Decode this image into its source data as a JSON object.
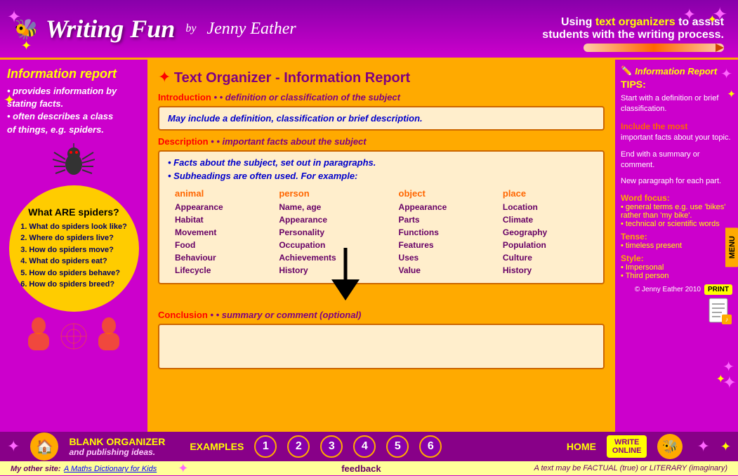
{
  "header": {
    "logo": "Writing Fun",
    "by": "by",
    "author": "Jenny Eather",
    "tagline_prefix": "Using ",
    "tagline_highlight": "text organizers",
    "tagline_suffix": " to assist",
    "tagline_line2": "students with the writing process."
  },
  "left_panel": {
    "title": "Information report",
    "bullet1": "• provides information by",
    "bullet1b": "  stating facts.",
    "bullet2": "• often describes a class",
    "bullet2b": "  of things, e.g. spiders.",
    "circle_title": "What ARE spiders?",
    "questions": [
      "1. What do spiders look like?",
      "2. Where do spiders live?",
      "3. How do spiders move?",
      "4. What do spiders eat?",
      "5. How do spiders behave?",
      "6. How do spiders breed?"
    ]
  },
  "center_panel": {
    "title": "Text Organizer - Information Report",
    "intro_header": "Introduction",
    "intro_subheader": "• definition or classification of the subject",
    "intro_box": "May include a definition, classification or brief description.",
    "desc_header": "Description",
    "desc_subheader": "• important facts about the subject",
    "desc_bullet1": "• Facts about the subject, set out in paragraphs.",
    "desc_bullet2": "• Subheadings are often used. For example:",
    "table_headers": [
      "animal",
      "person",
      "object",
      "place"
    ],
    "table_cols": [
      [
        "Appearance",
        "Habitat",
        "Movement",
        "Food",
        "Behaviour",
        "Lifecycle"
      ],
      [
        "Name, age",
        "Appearance",
        "Personality",
        "Occupation",
        "Achievements",
        "History"
      ],
      [
        "Appearance",
        "Parts",
        "Functions",
        "Features",
        "Uses",
        "Value"
      ],
      [
        "Location",
        "Climate",
        "Geography",
        "Population",
        "Culture",
        "History"
      ]
    ],
    "conclusion_header": "Conclusion",
    "conclusion_subheader": "• summary or comment (optional)"
  },
  "right_panel": {
    "section_title": "Information Report",
    "tips_title": "TIPS:",
    "tip1": "Start with a definition or brief classification.",
    "tip2_label": "Include the most",
    "tip2": "important facts about your topic.",
    "tip3": "End with a summary or comment.",
    "tip4": "New paragraph for each part.",
    "word_focus_title": "Word focus:",
    "word_focus1": "• general terms e.g. use 'bikes' rather than 'my bike'.",
    "word_focus2": "• technical or scientific words",
    "tense_title": "Tense:",
    "tense_val": "• timeless present",
    "style_title": "Style:",
    "style1": "• Impersonal",
    "style2": "• Third person",
    "print": "PRINT",
    "copyright": "© Jenny Eather 2010"
  },
  "bottom_bar": {
    "blank_organizer": "BLANK ORGANIZER",
    "publishing": "and publishing ideas.",
    "examples": "EXAMPLES",
    "numbers": [
      "1",
      "2",
      "3",
      "4",
      "5",
      "6"
    ],
    "home": "HOME",
    "write_online": "WRITE\nONLINE",
    "menu": "MENU"
  },
  "footer": {
    "my_other_site": "My other site:",
    "link": "A Maths Dictionary for Kids",
    "feedback": "feedback",
    "factual": "A text may be FACTUAL (true) or LITERARY (imaginary)"
  }
}
